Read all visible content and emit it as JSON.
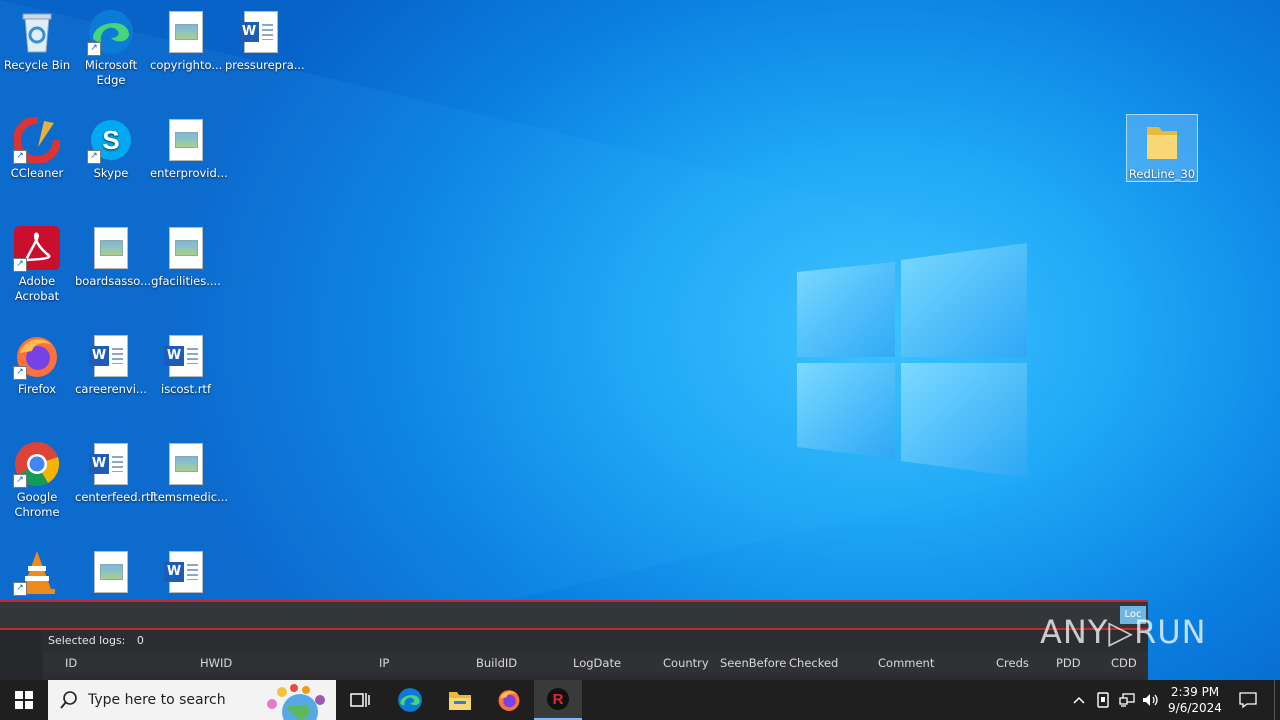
{
  "desktop_icons": [
    {
      "label": "Recycle Bin"
    },
    {
      "label": "Microsoft Edge"
    },
    {
      "label": "copyrighto..."
    },
    {
      "label": "pressurepra..."
    },
    {
      "label": "CCleaner"
    },
    {
      "label": "Skype"
    },
    {
      "label": "enterprovid..."
    },
    {
      "label": "Adobe Acrobat"
    },
    {
      "label": "boardsasso..."
    },
    {
      "label": "gfacilities...."
    },
    {
      "label": "Firefox"
    },
    {
      "label": "careerenvi..."
    },
    {
      "label": "iscost.rtf"
    },
    {
      "label": "Google Chrome"
    },
    {
      "label": "centerfeed.rtf"
    },
    {
      "label": "itemsmedic..."
    },
    {
      "label": "RedLine_30"
    }
  ],
  "redline_panel": {
    "selected_logs_label": "Selected logs:",
    "selected_logs_value": "0",
    "log_icon_label": "Loc",
    "columns": [
      "ID",
      "HWID",
      "IP",
      "BuildID",
      "LogDate",
      "Country",
      "SeenBefore",
      "Checked",
      "Comment",
      "Creds",
      "PDD",
      "CDD"
    ]
  },
  "watermark": "ANY▷RUN",
  "taskbar": {
    "search_placeholder": "Type here to search",
    "clock_time": "2:39 PM",
    "clock_date": "9/6/2024"
  },
  "colors": {
    "desktop_blue": "#0a7fe0",
    "panel_border": "#c62828",
    "taskbar": "#1f1f1f"
  }
}
